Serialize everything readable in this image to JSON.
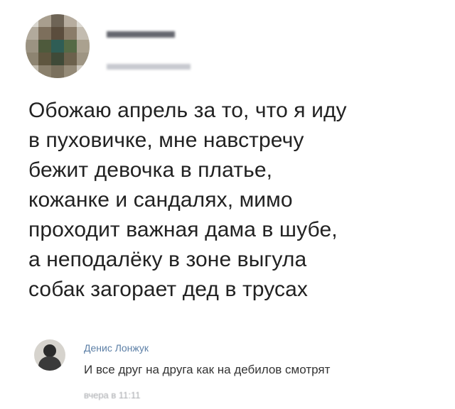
{
  "post": {
    "text": "Обожаю апрель за то, что я иду\nв пуховичке, мне навстречу\nбежит девочка в платье,\nкожанке и сандалях, мимо\nпроходит важная дама в шубе,\nа неподалёку в зоне выгула\nсобак загорает дед в трусах"
  },
  "comment": {
    "author": "Денис Лонжук",
    "text": "И все друг на друга как на дебилов смотрят",
    "time": "вчера в 11:11"
  },
  "colors": {
    "link": "#5c7fa6",
    "text": "#222222",
    "muted": "#a8aaae"
  }
}
